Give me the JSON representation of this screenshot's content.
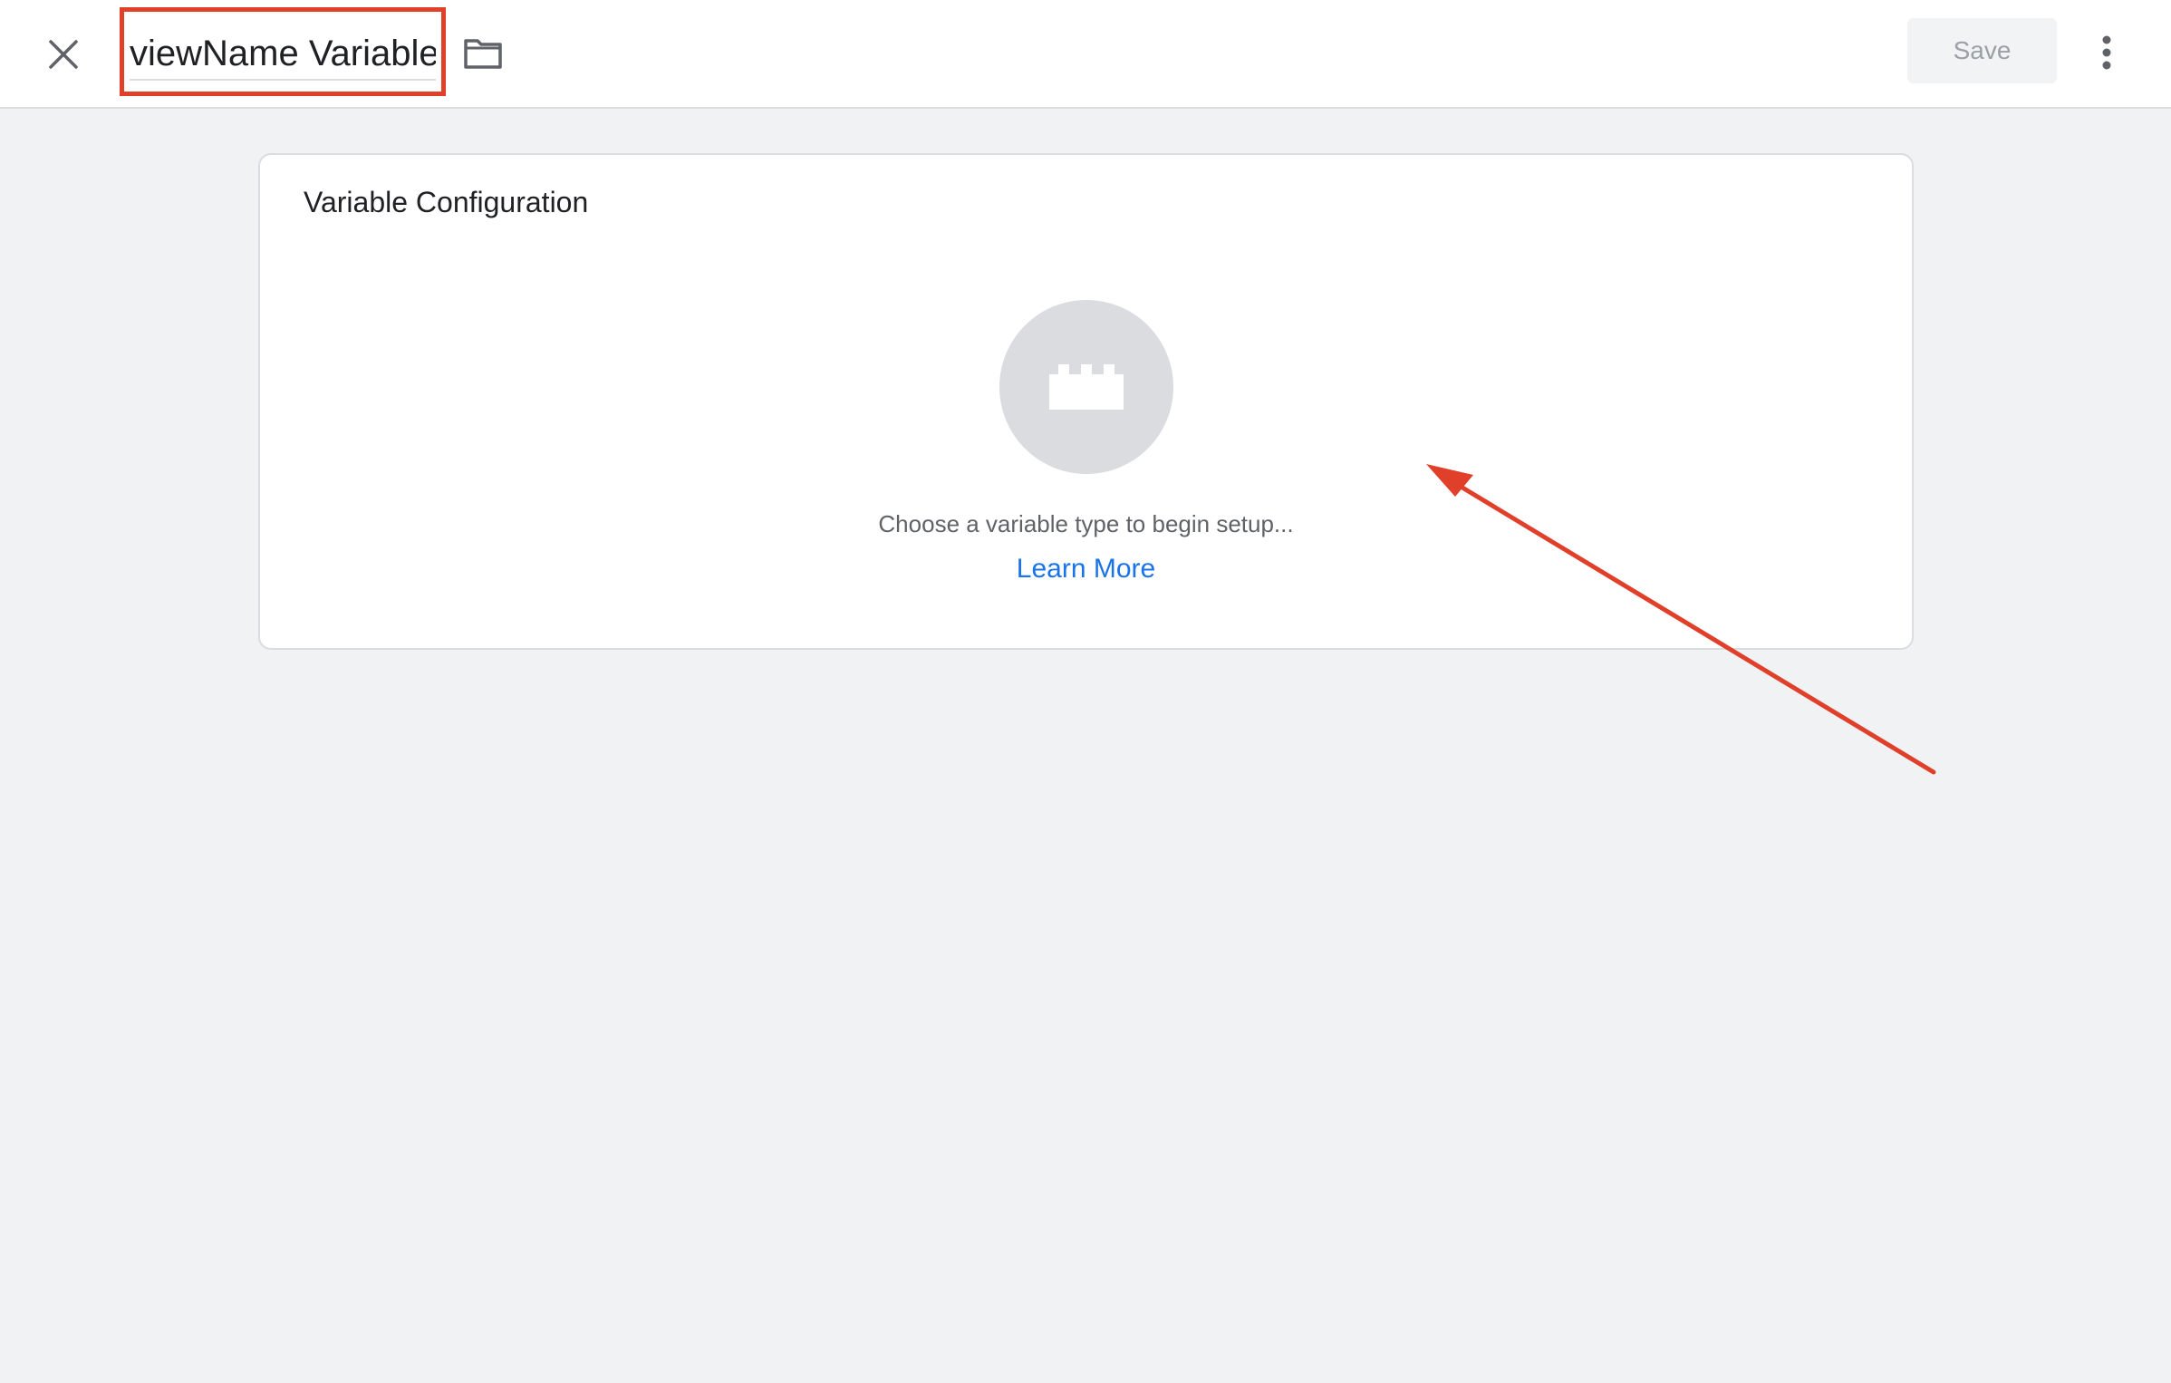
{
  "header": {
    "title_value": "viewName Variable",
    "save_label": "Save"
  },
  "card": {
    "title": "Variable Configuration",
    "hint": "Choose a variable type to begin setup...",
    "learn_more": "Learn More"
  },
  "icons": {
    "close": "close-icon",
    "folder": "folder-icon",
    "more": "more-vert-icon",
    "variable_type": "brick-icon"
  },
  "colors": {
    "accent_link": "#1a73e8",
    "annotation": "#e0402a",
    "background": "#f1f2f4"
  }
}
